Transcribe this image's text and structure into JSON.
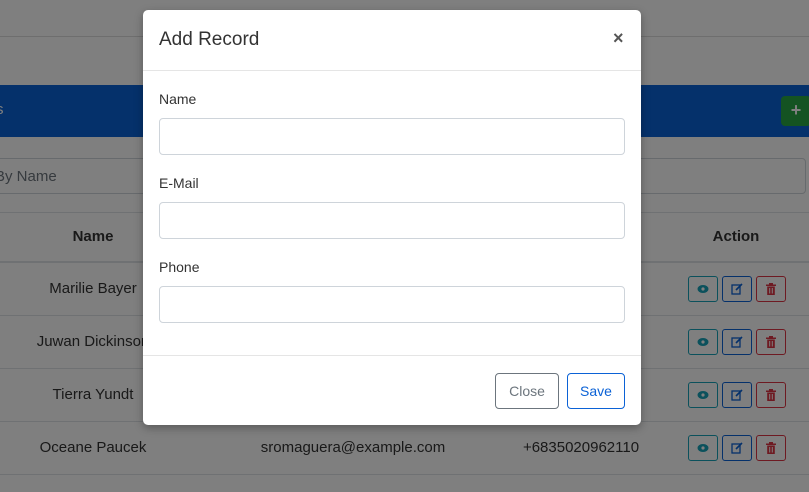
{
  "background": {
    "panel_title": "s",
    "add_button_label": "+",
    "search": {
      "placeholder": "By Name"
    },
    "table": {
      "headers": {
        "name": "Name",
        "action": "Action"
      },
      "rows": [
        {
          "name": "Marilie Bayer",
          "email": "",
          "phone": ""
        },
        {
          "name": "Juwan Dickinson",
          "email": "",
          "phone": ""
        },
        {
          "name": "Tierra Yundt",
          "email": "",
          "phone": ""
        },
        {
          "name": "Oceane Paucek",
          "email": "sromaguera@example.com",
          "phone": "+6835020962110"
        }
      ]
    },
    "colors": {
      "primary": "#0b62d6",
      "success": "#28a745",
      "info": "#17a2b8",
      "danger": "#dc3545"
    }
  },
  "modal": {
    "title": "Add Record",
    "close_symbol": "×",
    "fields": [
      {
        "label": "Name",
        "value": "",
        "placeholder": ""
      },
      {
        "label": "E-Mail",
        "value": "",
        "placeholder": ""
      },
      {
        "label": "Phone",
        "value": "",
        "placeholder": ""
      }
    ],
    "buttons": {
      "close": "Close",
      "save": "Save"
    }
  },
  "icons": {
    "view": "eye-icon",
    "edit": "edit-icon",
    "delete": "trash-icon",
    "add": "plus-icon"
  }
}
